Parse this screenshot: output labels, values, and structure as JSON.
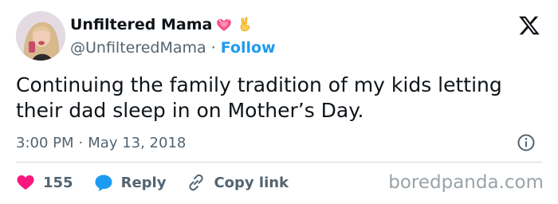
{
  "author": {
    "display_name": "Unfiltered Mama",
    "handle": "@UnfilteredMama",
    "separator": "·",
    "follow_label": "Follow",
    "name_emojis": [
      "sparkling-heart-icon",
      "victory-hand-icon"
    ]
  },
  "tweet": {
    "text": "Continuing the family tradition of my kids letting\ntheir dad sleep in on Mother’s Day.",
    "time": "3:00 PM",
    "date": "May 13, 2018",
    "separator": "·"
  },
  "actions": {
    "likes_count": "155",
    "reply_label": "Reply",
    "copy_link_label": "Copy link"
  },
  "watermark": "boredpanda.com",
  "colors": {
    "accent": "#1d9bf0",
    "like": "#f91880",
    "text": "#0f1419",
    "muted": "#536471"
  }
}
